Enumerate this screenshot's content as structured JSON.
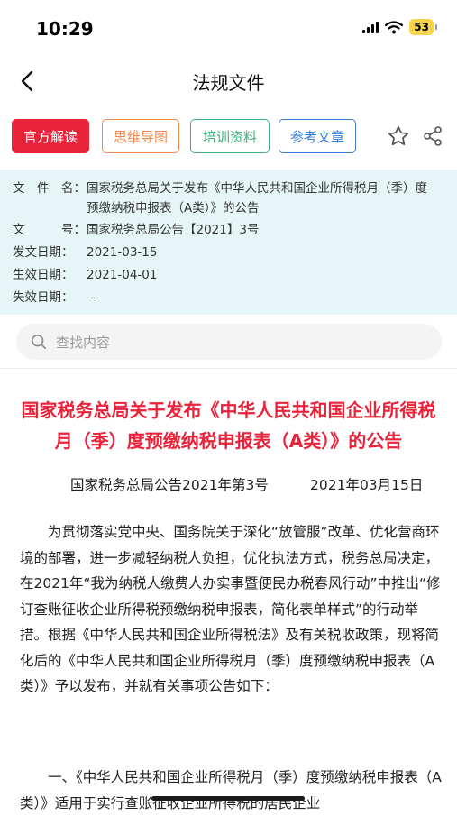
{
  "status": {
    "time": "10:29",
    "battery": "53",
    "icons": [
      "cellular-signal-icon",
      "wifi-icon",
      "battery-icon"
    ]
  },
  "nav": {
    "title": "法规文件",
    "back_icon": "chevron-left-icon"
  },
  "tags": [
    {
      "label": "官方解读",
      "color": "#e8233a"
    },
    {
      "label": "思维导图",
      "color": "#f0894f"
    },
    {
      "label": "培训资料",
      "color": "#3bb27c"
    },
    {
      "label": "参考文章",
      "color": "#3a7bd8"
    }
  ],
  "actions": {
    "favorite_icon": "star-outline-icon",
    "share_icon": "share-icon"
  },
  "info": {
    "background": "#e6f6f6",
    "rows": [
      {
        "label": "文　件　名：",
        "value": "国家税务总局关于发布《中华人民共和国企业所得税月（季）度预缴纳税申报表（A类）》的公告"
      },
      {
        "label": "文　　　号：",
        "value": "国家税务总局公告【2021】3号"
      },
      {
        "label": "发文日期：",
        "value": "2021-03-15"
      },
      {
        "label": "生效日期：",
        "value": "2021-04-01"
      },
      {
        "label": "失效日期：",
        "value": "--"
      }
    ]
  },
  "search": {
    "placeholder": "查找内容"
  },
  "document": {
    "title": "国家税务总局关于发布《中华人民共和国企业所得税月（季）度预缴纳税申报表（A类）》的公告",
    "doc_no": "国家税务总局公告2021年第3号",
    "date": "2021年03月15日",
    "paragraphs": [
      "为贯彻落实党中央、国务院关于深化“放管服”改革、优化营商环境的部署，进一步减轻纳税人负担，优化执法方式，税务总局决定，在2021年“我为纳税人缴费人办实事暨便民办税春风行动”中推出“修订查账征收企业所得税预缴纳税申报表，简化表单样式”的行动举措。根据《中华人民共和国企业所得税法》及有关税收政策，现将简化后的《中华人民共和国企业所得税月（季）度预缴纳税申报表（A类）》予以发布，并就有关事项公告如下：",
      "一、《中华人民共和国企业所得税月（季）度预缴纳税申报表（A类）》适用于实行查账征收企业所得税的居民企业"
    ],
    "title_color": "#e8233a"
  }
}
